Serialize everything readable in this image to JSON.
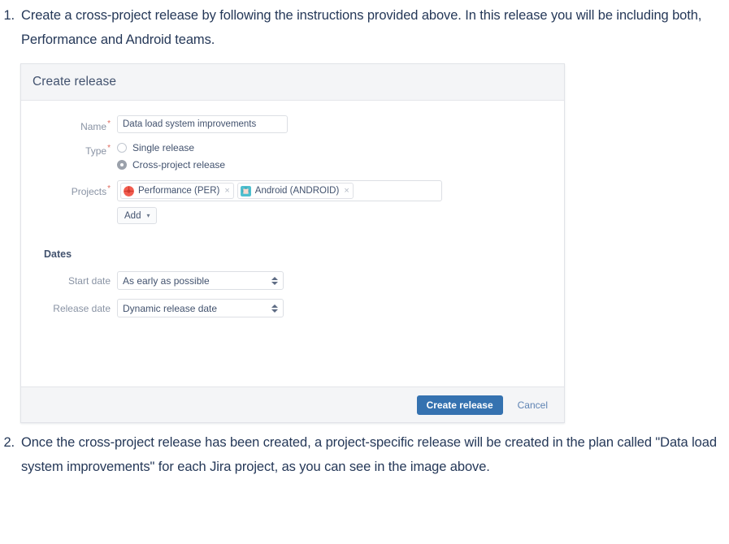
{
  "steps": [
    {
      "number": "1.",
      "text": "Create a cross-project release by following the instructions provided above. In this release you will be including both, Performance and Android teams."
    },
    {
      "number": "2.",
      "text": "Once the cross-project release has been created, a project-specific release will be created in the plan called \"Data load system improvements\" for each Jira  project, as you can see in the image above."
    }
  ],
  "dialog": {
    "title": "Create release",
    "fields": {
      "name": {
        "label": "Name",
        "required_marker": "*",
        "value": "Data load system improvements",
        "placeholder": ""
      },
      "type": {
        "label": "Type",
        "required_marker": "*",
        "options": [
          {
            "label": "Single release",
            "selected": false
          },
          {
            "label": "Cross-project release",
            "selected": true
          }
        ]
      },
      "projects": {
        "label": "Projects",
        "required_marker": "*",
        "placeholder": "",
        "input_value": "",
        "tokens": [
          {
            "label": "Performance (PER)",
            "remove_label": "×",
            "avatar_icon": "performance-project-avatar",
            "avatar_color": "#f15c4f",
            "avatar_shape": "circle"
          },
          {
            "label": "Android (ANDROID)",
            "remove_label": "×",
            "avatar_icon": "android-project-avatar",
            "avatar_color": "#4fbfcf",
            "avatar_shape": "square"
          }
        ],
        "add_button": {
          "label": "Add",
          "caret": "▾"
        }
      }
    },
    "dates_section": {
      "title": "Dates",
      "start_date": {
        "label": "Start date",
        "value": "As early as possible"
      },
      "release_date": {
        "label": "Release date",
        "value": "Dynamic release date"
      }
    },
    "footer": {
      "submit_label": "Create release",
      "cancel_label": "Cancel"
    }
  },
  "colors": {
    "text": "#253858",
    "label": "#8993a4",
    "primary_button": "#3572b0",
    "required_asterisk": "#de6a5e",
    "header_background": "#f4f5f7"
  }
}
